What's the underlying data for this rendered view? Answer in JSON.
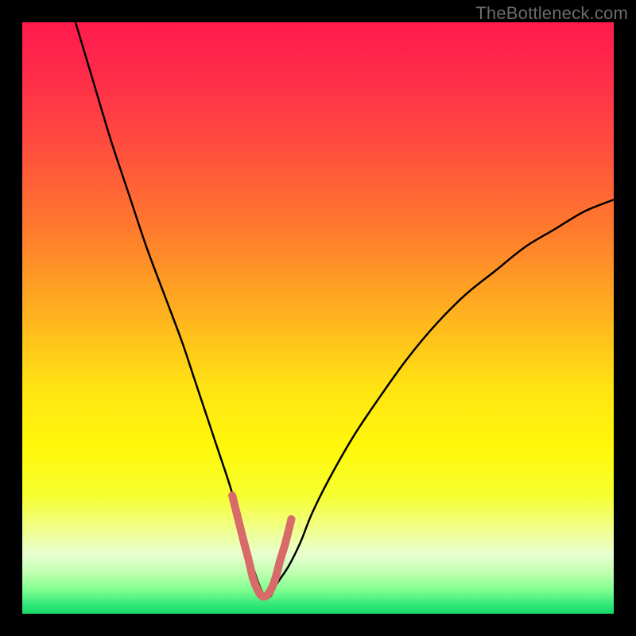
{
  "watermark": "TheBottleneck.com",
  "chart_data": {
    "type": "line",
    "title": "",
    "xlabel": "",
    "ylabel": "",
    "xlim": [
      0,
      100
    ],
    "ylim": [
      0,
      100
    ],
    "legend": false,
    "grid": false,
    "background_gradient_stops": [
      {
        "offset": 0.0,
        "color": "#ff1a4d"
      },
      {
        "offset": 0.08,
        "color": "#ff2a4a"
      },
      {
        "offset": 0.2,
        "color": "#ff4a3f"
      },
      {
        "offset": 0.35,
        "color": "#ff7a2d"
      },
      {
        "offset": 0.5,
        "color": "#ffb41e"
      },
      {
        "offset": 0.62,
        "color": "#ffe413"
      },
      {
        "offset": 0.72,
        "color": "#fff80a"
      },
      {
        "offset": 0.8,
        "color": "#f6ff30"
      },
      {
        "offset": 0.86,
        "color": "#f0ff90"
      },
      {
        "offset": 0.9,
        "color": "#e8ffd0"
      },
      {
        "offset": 0.93,
        "color": "#c0ffb0"
      },
      {
        "offset": 0.96,
        "color": "#80ff90"
      },
      {
        "offset": 0.985,
        "color": "#30e878"
      },
      {
        "offset": 1.0,
        "color": "#18d868"
      }
    ],
    "series": [
      {
        "name": "bottleneck-curve",
        "color": "#000000",
        "stroke_width": 2.5,
        "x": [
          9,
          12,
          15,
          18,
          21,
          24,
          27,
          29,
          31,
          33,
          35,
          36.5,
          38,
          39,
          40,
          41,
          42,
          43,
          45,
          47,
          49,
          52,
          56,
          60,
          65,
          70,
          75,
          80,
          85,
          90,
          95,
          100
        ],
        "values": [
          100,
          90,
          80,
          71,
          62,
          54,
          46,
          40,
          34,
          28,
          22,
          17,
          12,
          8,
          5,
          3,
          3,
          5,
          8,
          12,
          17,
          23,
          30,
          36,
          43,
          49,
          54,
          58,
          62,
          65,
          68,
          70
        ]
      },
      {
        "name": "valley-highlight",
        "color": "#d86a6a",
        "stroke_width": 10,
        "linecap": "round",
        "x": [
          35.5,
          36.5,
          37.5,
          38.3,
          39.0,
          39.8,
          40.5,
          41.2,
          42.0,
          42.8,
          43.6,
          44.5,
          45.5
        ],
        "values": [
          20,
          16,
          12,
          9,
          6,
          4,
          3,
          3,
          4,
          6,
          9,
          12,
          16
        ]
      }
    ]
  }
}
